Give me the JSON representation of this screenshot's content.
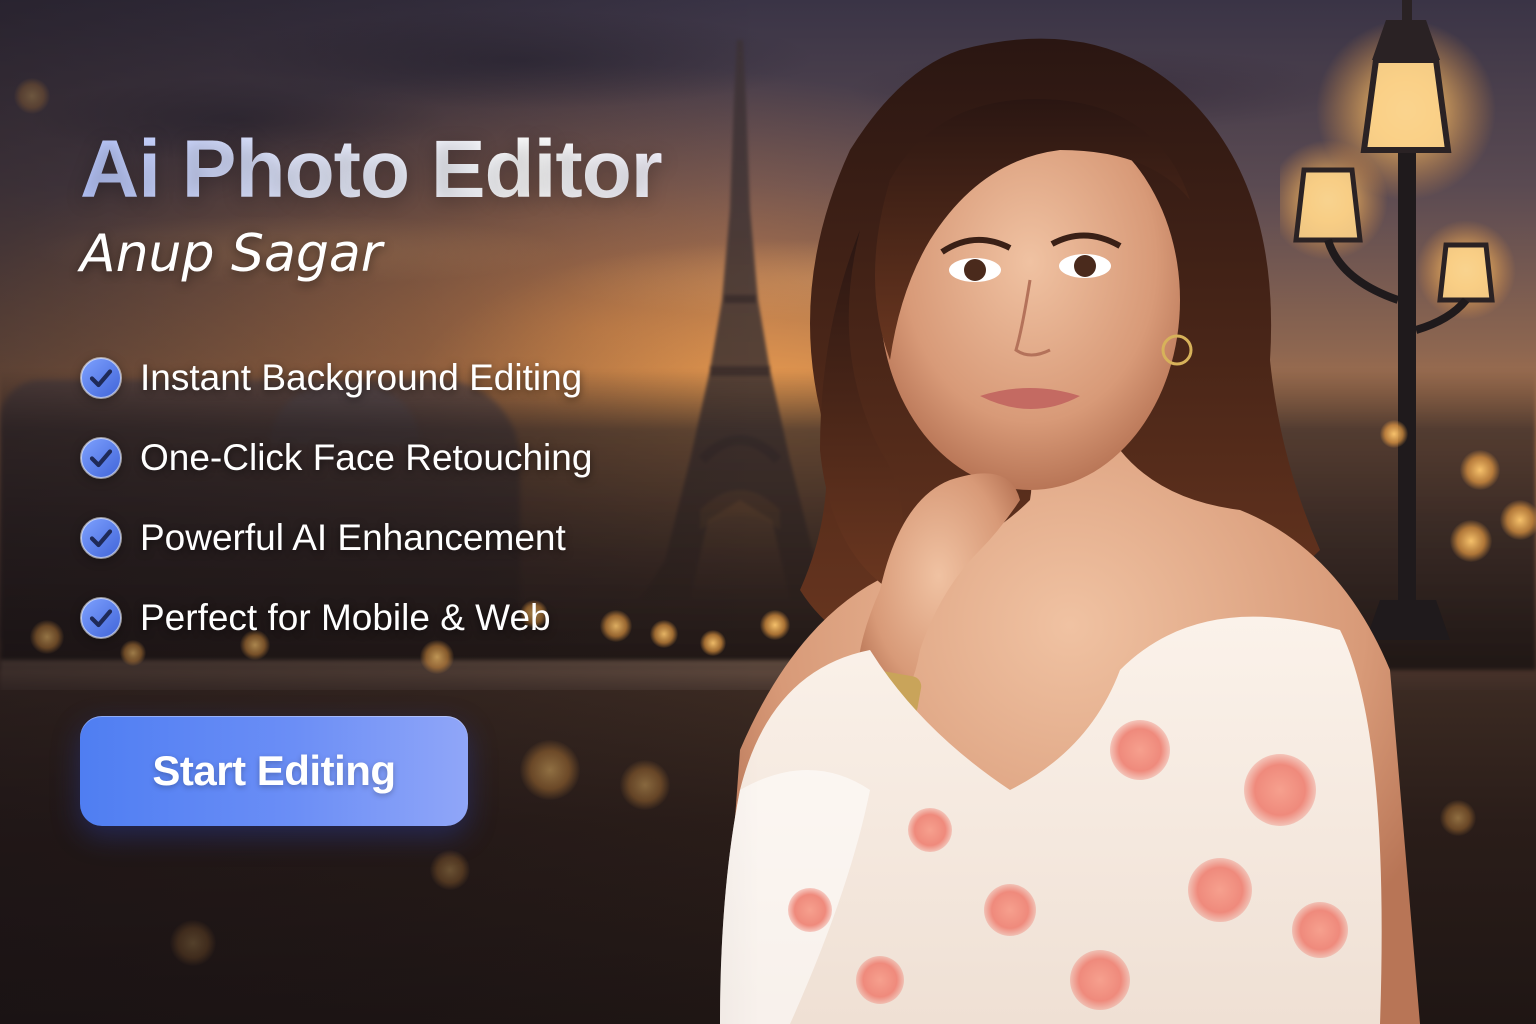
{
  "hero": {
    "title": "Ai Photo Editor",
    "subtitle": "Anup Sagar"
  },
  "features": [
    {
      "label": "Instant Background Editing",
      "icon": "check-badge-icon"
    },
    {
      "label": "One-Click Face Retouching",
      "icon": "check-badge-icon"
    },
    {
      "label": "Powerful AI Enhancement",
      "icon": "check-badge-icon"
    },
    {
      "label": "Perfect for Mobile & Web",
      "icon": "check-badge-icon"
    }
  ],
  "cta": {
    "label": "Start Editing"
  },
  "colors": {
    "accent": "#5b84f3",
    "accent_light": "#90a6f8",
    "title_tint": "#c9d4ff",
    "text": "#ffffff"
  }
}
